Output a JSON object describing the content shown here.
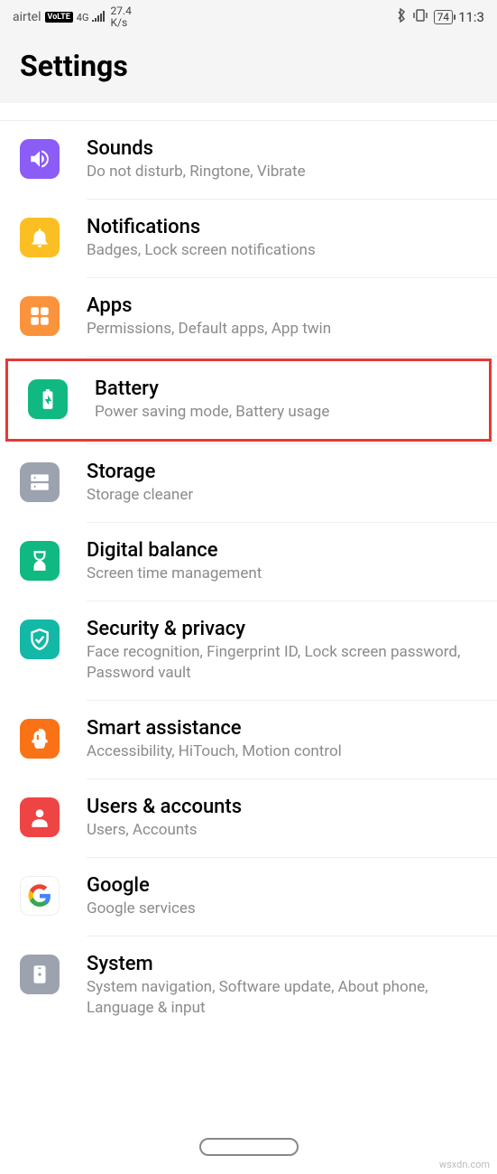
{
  "statusbar": {
    "carrier": "airtel",
    "volte": "VoLTE",
    "network": "4G",
    "speed_top": "27.4",
    "speed_bottom": "K/s",
    "battery": "74",
    "time": "11:3"
  },
  "header": {
    "title": "Settings"
  },
  "items": {
    "sounds": {
      "title": "Sounds",
      "subtitle": "Do not disturb, Ringtone, Vibrate"
    },
    "notifications": {
      "title": "Notifications",
      "subtitle": "Badges, Lock screen notifications"
    },
    "apps": {
      "title": "Apps",
      "subtitle": "Permissions, Default apps, App twin"
    },
    "battery": {
      "title": "Battery",
      "subtitle": "Power saving mode, Battery usage"
    },
    "storage": {
      "title": "Storage",
      "subtitle": "Storage cleaner"
    },
    "digitalbalance": {
      "title": "Digital balance",
      "subtitle": "Screen time management"
    },
    "security": {
      "title": "Security & privacy",
      "subtitle": "Face recognition, Fingerprint ID, Lock screen password, Password vault"
    },
    "smart": {
      "title": "Smart assistance",
      "subtitle": "Accessibility, HiTouch, Motion control"
    },
    "users": {
      "title": "Users & accounts",
      "subtitle": "Users, Accounts"
    },
    "google": {
      "title": "Google",
      "subtitle": "Google services"
    },
    "system": {
      "title": "System",
      "subtitle": "System navigation, Software update, About phone, Language & input"
    }
  },
  "watermark": "wsxdn.com"
}
